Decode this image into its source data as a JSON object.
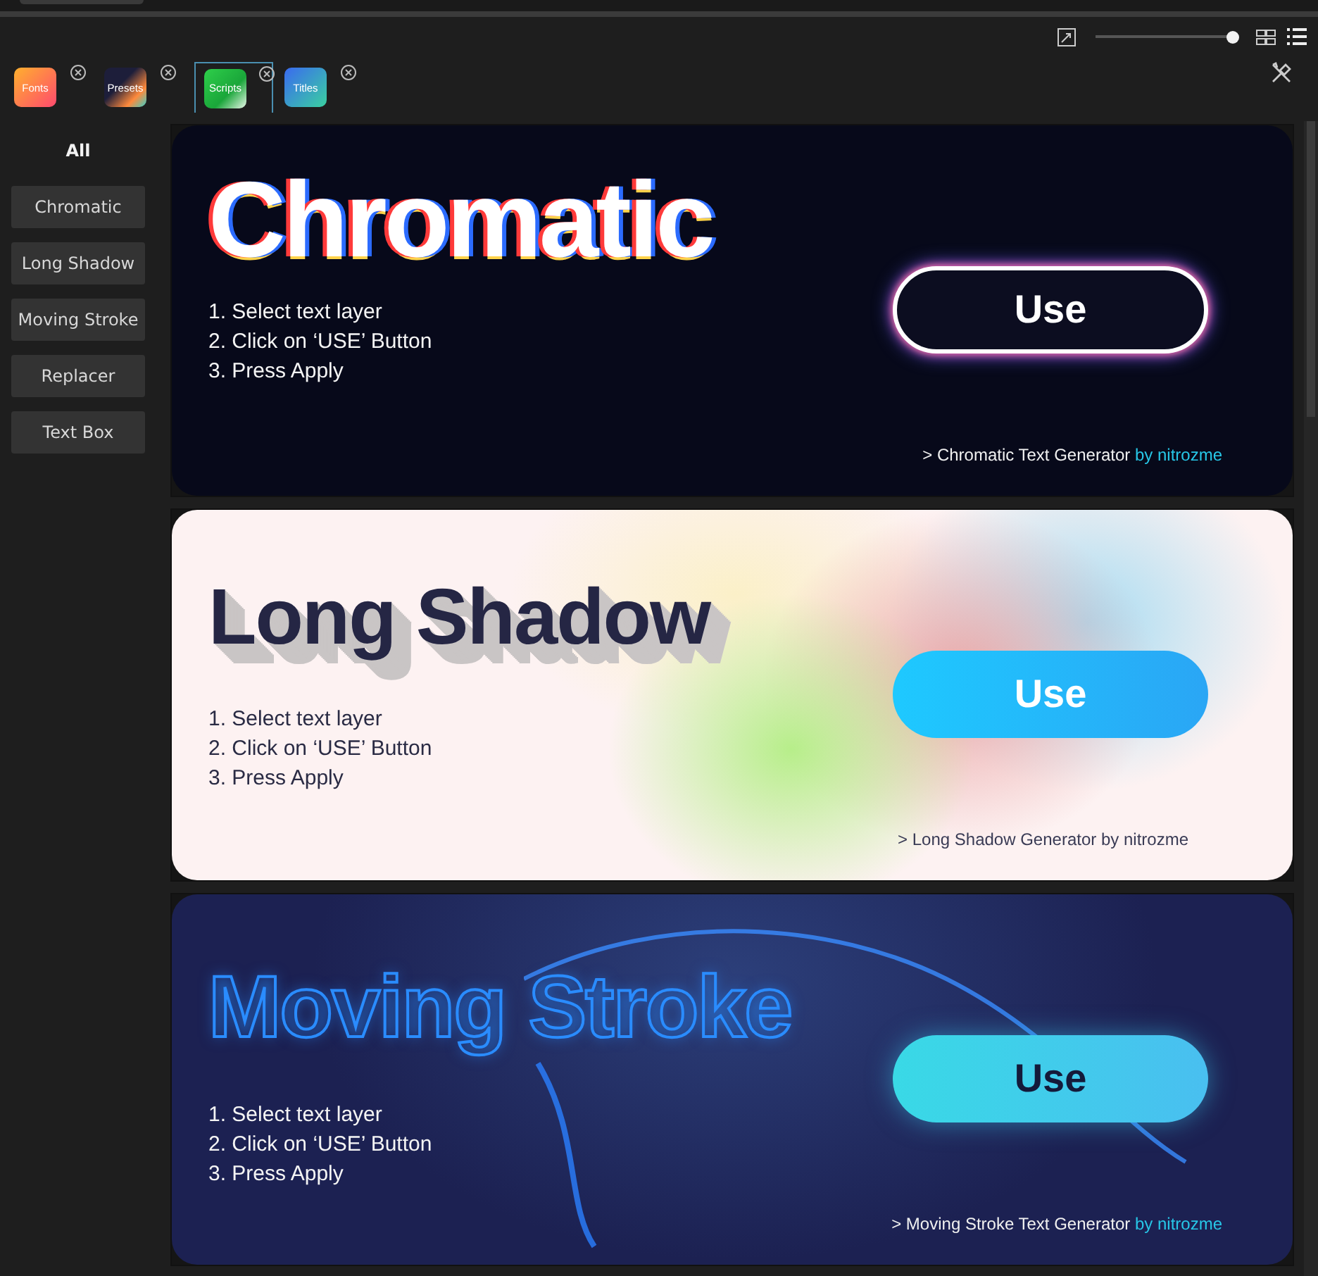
{
  "toolbar": {
    "zoom_slider": {
      "level": 0.97
    }
  },
  "tabs": [
    {
      "label": "Fonts",
      "kind": "fonts",
      "selected": false
    },
    {
      "label": "Presets",
      "kind": "presets",
      "selected": false
    },
    {
      "label": "Scripts",
      "kind": "scripts",
      "selected": true
    },
    {
      "label": "Titles",
      "kind": "titles",
      "selected": false
    }
  ],
  "sidebar": {
    "items": [
      {
        "label": "All",
        "selected": true
      },
      {
        "label": "Chromatic",
        "selected": false
      },
      {
        "label": "Long Shadow",
        "selected": false
      },
      {
        "label": "Moving Stroke",
        "selected": false
      },
      {
        "label": "Replacer",
        "selected": false
      },
      {
        "label": "Text Box",
        "selected": false
      }
    ]
  },
  "cards": [
    {
      "kind": "chromatic",
      "title": "Chromatic",
      "steps": [
        "1. Select text layer",
        "2. Click on ‘USE’ Button",
        "3. Press Apply"
      ],
      "button": "Use",
      "credit": "> Chromatic Text Generator",
      "author": "by nitrozme",
      "author_highlighted": true
    },
    {
      "kind": "long_shadow",
      "title": "Long Shadow",
      "steps": [
        "1. Select text layer",
        "2. Click on ‘USE’ Button",
        "3. Press Apply"
      ],
      "button": "Use",
      "credit": "> Long Shadow Generator",
      "author": "by nitrozme",
      "author_highlighted": false
    },
    {
      "kind": "moving_stroke",
      "title": "Moving Stroke",
      "steps": [
        "1. Select text layer",
        "2. Click on ‘USE’ Button",
        "3. Press Apply"
      ],
      "button": "Use",
      "credit": "> Moving Stroke Text Generator",
      "author": "by nitrozme",
      "author_highlighted": true
    }
  ]
}
